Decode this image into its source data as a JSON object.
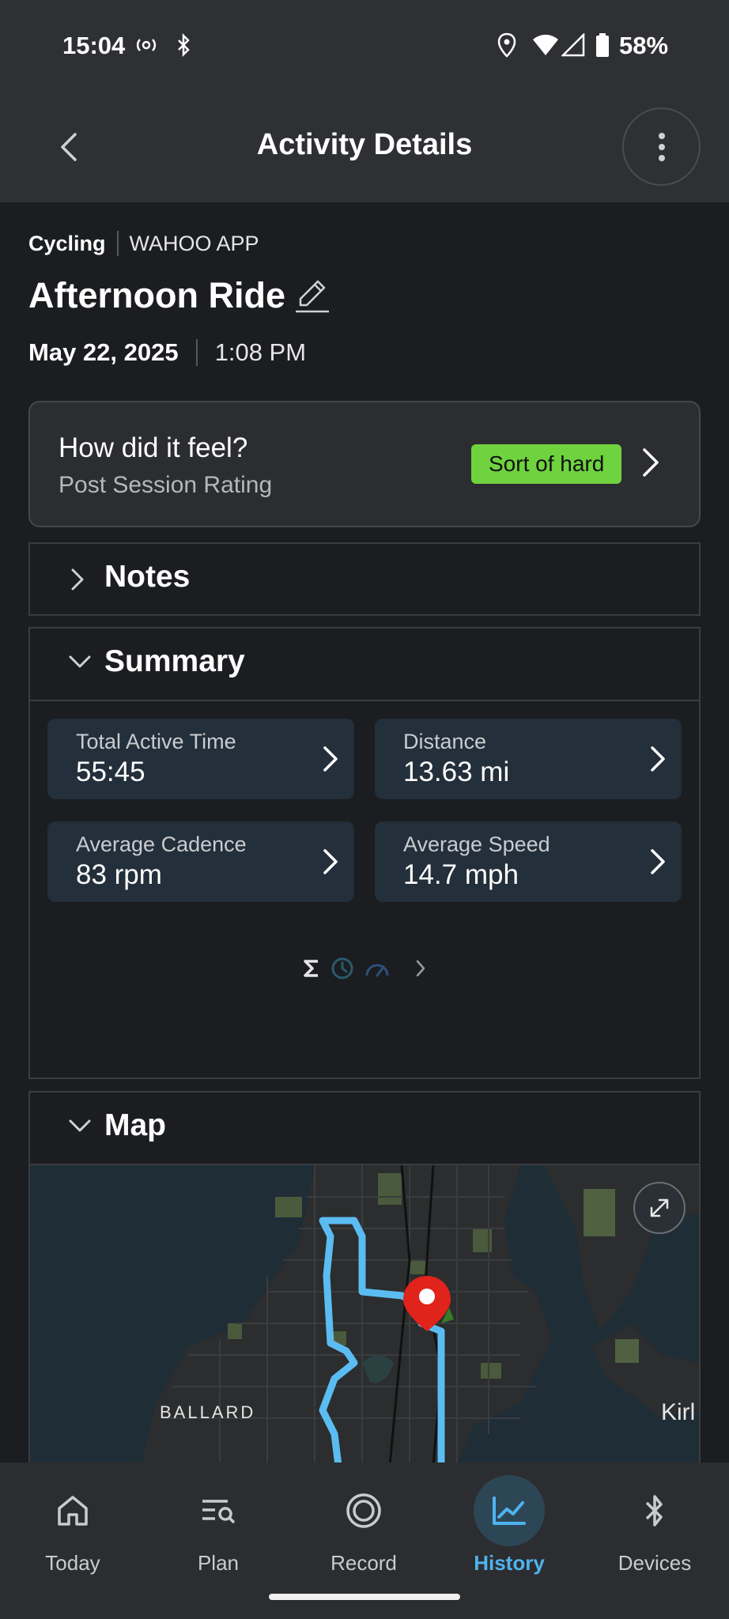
{
  "status_bar": {
    "time": "15:04",
    "battery": "58%"
  },
  "app_bar": {
    "title": "Activity Details"
  },
  "activity": {
    "type": "Cycling",
    "source": "WAHOO APP",
    "title": "Afternoon Ride",
    "date": "May 22, 2025",
    "time": "1:08 PM"
  },
  "feel_card": {
    "title": "How did it feel?",
    "subtitle": "Post Session Rating",
    "rating": "Sort of hard",
    "rating_color": "#6fd23f"
  },
  "sections": {
    "notes": {
      "title": "Notes"
    },
    "summary": {
      "title": "Summary"
    },
    "map": {
      "title": "Map"
    }
  },
  "summary_metrics": [
    {
      "label": "Total Active Time",
      "value": "55:45"
    },
    {
      "label": "Distance",
      "value": "13.63 mi"
    },
    {
      "label": "Average Cadence",
      "value": "83 rpm"
    },
    {
      "label": "Average Speed",
      "value": "14.7 mph"
    }
  ],
  "map": {
    "labels": {
      "ballard": "BALLARD",
      "kirkland": "Kirl"
    }
  },
  "bottom_nav": {
    "items": [
      {
        "label": "Today",
        "icon": "home-icon"
      },
      {
        "label": "Plan",
        "icon": "plan-search-icon"
      },
      {
        "label": "Record",
        "icon": "record-icon"
      },
      {
        "label": "History",
        "icon": "history-chart-icon"
      },
      {
        "label": "Devices",
        "icon": "bluetooth-icon"
      }
    ],
    "active": "History"
  },
  "colors": {
    "accent": "#4fb3ee",
    "route": "#5bbcf2",
    "pin": "#e0231b"
  }
}
